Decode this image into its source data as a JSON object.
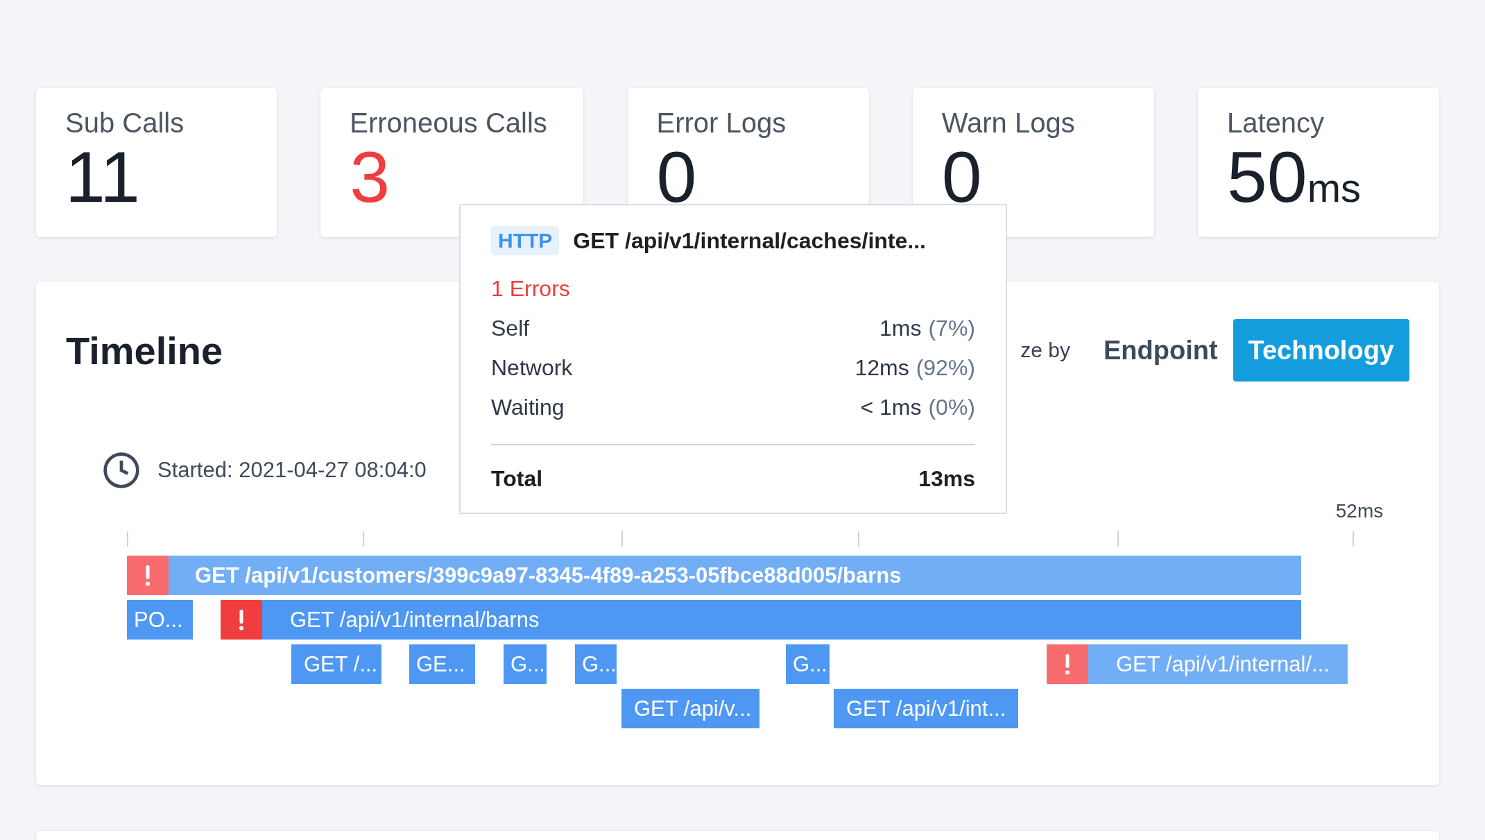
{
  "stats": [
    {
      "label": "Sub Calls",
      "value": "11",
      "error": false
    },
    {
      "label": "Erroneous Calls",
      "value": "3",
      "error": true
    },
    {
      "label": "Error Logs",
      "value": "0",
      "error": false
    },
    {
      "label": "Warn Logs",
      "value": "0",
      "error": false
    },
    {
      "label": "Latency",
      "value": "50",
      "unit": "ms",
      "error": false
    }
  ],
  "timeline": {
    "title": "Timeline",
    "colorize_label": "ze by",
    "colorize_options": [
      {
        "label": "Endpoint",
        "selected": false
      },
      {
        "label": "Technology",
        "selected": true
      }
    ],
    "started": "Started: 2021-04-27 08:04:0",
    "axis_end": "52ms",
    "rows": [
      [
        {
          "label": "GET /api/v1/customers/399c9a97-8345-4f89-a253-05fbce88d005/barns",
          "error": true,
          "highlighted": true
        }
      ],
      [
        {
          "label": "PO...",
          "error": false,
          "highlighted": false
        },
        {
          "label": "GET /api/v1/internal/barns",
          "error": true,
          "highlighted": false
        }
      ],
      [
        {
          "label": "GET /...",
          "error": false,
          "highlighted": false
        },
        {
          "label": "GE...",
          "error": false,
          "highlighted": false
        },
        {
          "label": "G...",
          "error": false,
          "highlighted": false
        },
        {
          "label": "G...",
          "error": false,
          "highlighted": false
        },
        {
          "label": "G...",
          "error": false,
          "highlighted": false
        },
        {
          "label": "GET /api/v1/internal/...",
          "error": true,
          "highlighted": true
        }
      ],
      [
        {
          "label": "GET /api/v...",
          "error": false,
          "highlighted": false
        },
        {
          "label": "GET /api/v1/int...",
          "error": false,
          "highlighted": false
        }
      ]
    ]
  },
  "tooltip": {
    "badge": "HTTP",
    "title": "GET /api/v1/internal/caches/inte...",
    "errors": "1 Errors",
    "rows": [
      {
        "label": "Self",
        "value": "1ms",
        "percent": "(7%)"
      },
      {
        "label": "Network",
        "value": "12ms",
        "percent": "(92%)"
      },
      {
        "label": "Waiting",
        "value": "< 1ms",
        "percent": "(0%)"
      }
    ],
    "total_label": "Total",
    "total_value": "13ms"
  }
}
